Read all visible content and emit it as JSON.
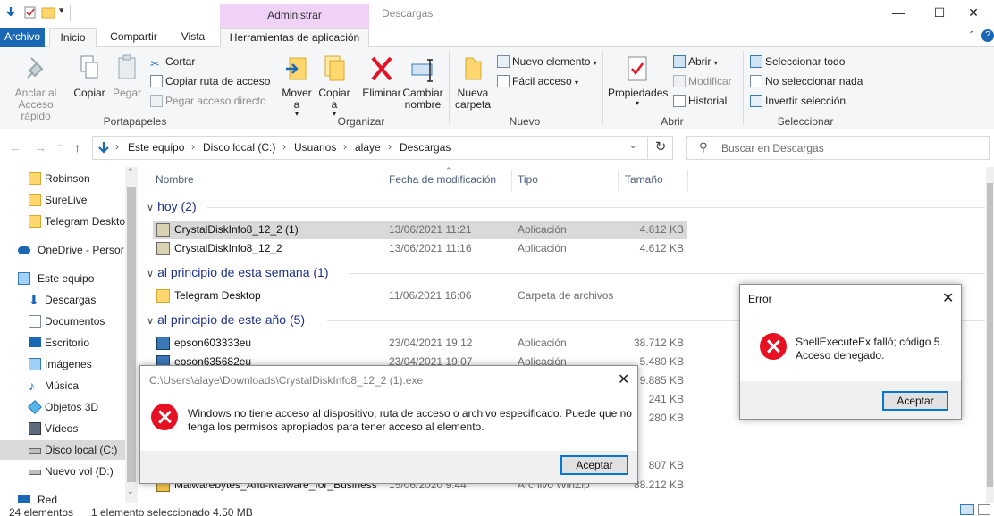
{
  "window": {
    "title": "Descargas",
    "context_group": "Administrar",
    "controls": [
      "—",
      "☐",
      "✕"
    ]
  },
  "tabs": {
    "file": "Archivo",
    "home": "Inicio",
    "share": "Compartir",
    "view": "Vista",
    "app_tools": "Herramientas de aplicación"
  },
  "ribbon": {
    "portapapeles": {
      "label": "Portapapeles",
      "pin": "Anclar al Acceso rápido",
      "copy": "Copiar",
      "paste": "Pegar",
      "cut": "Cortar",
      "copy_path": "Copiar ruta de acceso",
      "paste_shortcut": "Pegar acceso directo"
    },
    "organizar": {
      "label": "Organizar",
      "move": "Mover a",
      "copy_to": "Copiar a",
      "delete": "Eliminar",
      "rename": "Cambiar nombre"
    },
    "nuevo": {
      "label": "Nuevo",
      "new_folder": "Nueva carpeta",
      "new_item": "Nuevo elemento",
      "easy_access": "Fácil acceso"
    },
    "abrir": {
      "label": "Abrir",
      "properties": "Propiedades",
      "open": "Abrir",
      "edit": "Modificar",
      "history": "Historial"
    },
    "seleccionar": {
      "label": "Seleccionar",
      "select_all": "Seleccionar todo",
      "select_none": "No seleccionar nada",
      "invert": "Invertir selección"
    }
  },
  "address": {
    "breadcrumbs": [
      "Este equipo",
      "Disco local (C:)",
      "Usuarios",
      "alaye",
      "Descargas"
    ],
    "search_placeholder": "Buscar en Descargas"
  },
  "sidebar": {
    "items": [
      {
        "label": "Robinson",
        "icon": "folder-icon"
      },
      {
        "label": "SureLive",
        "icon": "folder-icon"
      },
      {
        "label": "Telegram Deskto",
        "icon": "folder-icon"
      },
      {
        "label": "OneDrive - Persor",
        "icon": "cloud-icon"
      },
      {
        "label": "Este equipo",
        "icon": "computer-icon"
      },
      {
        "label": "Descargas",
        "icon": "download-icon"
      },
      {
        "label": "Documentos",
        "icon": "documents-icon"
      },
      {
        "label": "Escritorio",
        "icon": "desktop-icon"
      },
      {
        "label": "Imágenes",
        "icon": "pictures-icon"
      },
      {
        "label": "Música",
        "icon": "music-icon"
      },
      {
        "label": "Objetos 3D",
        "icon": "objects-3d-icon"
      },
      {
        "label": "Vídeos",
        "icon": "videos-icon"
      },
      {
        "label": "Disco local (C:)",
        "icon": "drive-icon"
      },
      {
        "label": "Nuevo vol (D:)",
        "icon": "drive-icon"
      },
      {
        "label": "Red",
        "icon": "network-icon"
      }
    ]
  },
  "columns": {
    "name": "Nombre",
    "date": "Fecha de modificación",
    "type": "Tipo",
    "size": "Tamaño"
  },
  "groups": [
    {
      "label": "hoy (2)"
    },
    {
      "label": "al principio de esta semana (1)"
    },
    {
      "label": "al principio de este año (5)"
    }
  ],
  "files": [
    {
      "name": "CrystalDiskInfo8_12_2 (1)",
      "date": "13/06/2021 11:21",
      "type": "Aplicación",
      "size": "4.612 KB"
    },
    {
      "name": "CrystalDiskInfo8_12_2",
      "date": "13/06/2021 11:16",
      "type": "Aplicación",
      "size": "4.612 KB"
    },
    {
      "name": "Telegram Desktop",
      "date": "11/06/2021 16:06",
      "type": "Carpeta de archivos",
      "size": ""
    },
    {
      "name": "epson603333eu",
      "date": "23/04/2021 19:12",
      "type": "Aplicación",
      "size": "38.712 KB"
    },
    {
      "name": "epson635682eu",
      "date": "23/04/2021 19:07",
      "type": "Aplicación",
      "size": "5.480 KB"
    },
    {
      "name": "",
      "date": "",
      "type": "",
      "size": "9.885 KB"
    },
    {
      "name": "",
      "date": "",
      "type": "",
      "size": "241 KB"
    },
    {
      "name": "",
      "date": "",
      "type": "",
      "size": "280 KB"
    },
    {
      "name": "",
      "date": "",
      "type": "",
      "size": "807 KB"
    },
    {
      "name": "Malwarebytes_Anti-Malware_for_Business",
      "date": "15/06/2020 9:44",
      "type": "Archivo WinZip",
      "size": "88.212 KB"
    }
  ],
  "status": {
    "count": "24 elementos",
    "selection": "1 elemento seleccionado  4,50 MB"
  },
  "dialog_main": {
    "title": "C:\\Users\\alaye\\Downloads\\CrystalDiskInfo8_12_2 (1).exe",
    "message": "Windows no tiene acceso al dispositivo, ruta de acceso o archivo especificado. Puede que no tenga los permisos apropiados para tener acceso al elemento.",
    "button": "Aceptar"
  },
  "dialog_error": {
    "title": "Error",
    "message_line1": "ShellExecuteEx falló; código 5.",
    "message_line2": "Acceso denegado.",
    "button": "Aceptar"
  },
  "colors": {
    "file_tab": "#1a68b5",
    "context_tab": "#f0d2f7",
    "selection": "#cce8ff",
    "error_red": "#e81123",
    "button_focus": "#0078d7"
  }
}
